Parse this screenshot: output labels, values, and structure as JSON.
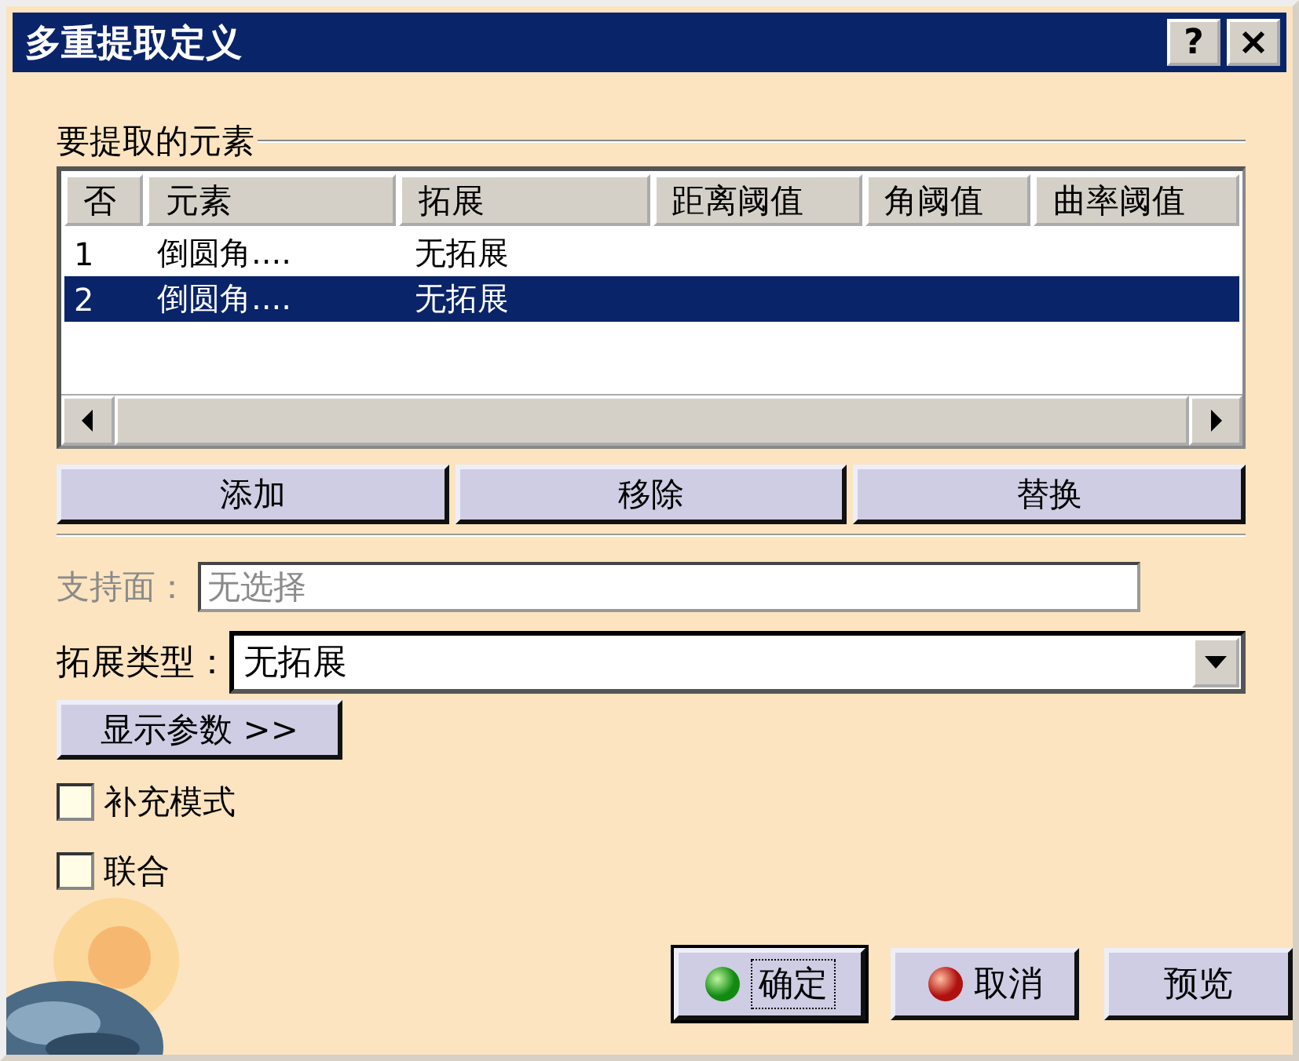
{
  "window": {
    "title": "多重提取定义",
    "help": "?"
  },
  "group": {
    "label": "要提取的元素"
  },
  "table": {
    "columns": [
      "否",
      "元素",
      "拓展",
      "距离阈值",
      "角阈值",
      "曲率阈值"
    ],
    "rows": [
      {
        "cells": [
          "1",
          "倒圆角....",
          "无拓展"
        ],
        "selected": false
      },
      {
        "cells": [
          "2",
          "倒圆角....",
          "无拓展"
        ],
        "selected": true
      }
    ]
  },
  "list_buttons": [
    "添加",
    "移除",
    "替换"
  ],
  "support": {
    "label": "支持面：",
    "value": "无选择",
    "disabled": true
  },
  "extension_type": {
    "label": "拓展类型：",
    "value": "无拓展"
  },
  "show_params_button": "显示参数 >>",
  "checkboxes": [
    {
      "label": "补充模式",
      "checked": false
    },
    {
      "label": "联合",
      "checked": false
    }
  ],
  "dialog_buttons": [
    {
      "kind": "ok",
      "label": "确定",
      "focused": true
    },
    {
      "kind": "cancel",
      "label": "取消",
      "focused": false
    },
    {
      "kind": "preview",
      "label": "预览",
      "focused": false
    }
  ]
}
